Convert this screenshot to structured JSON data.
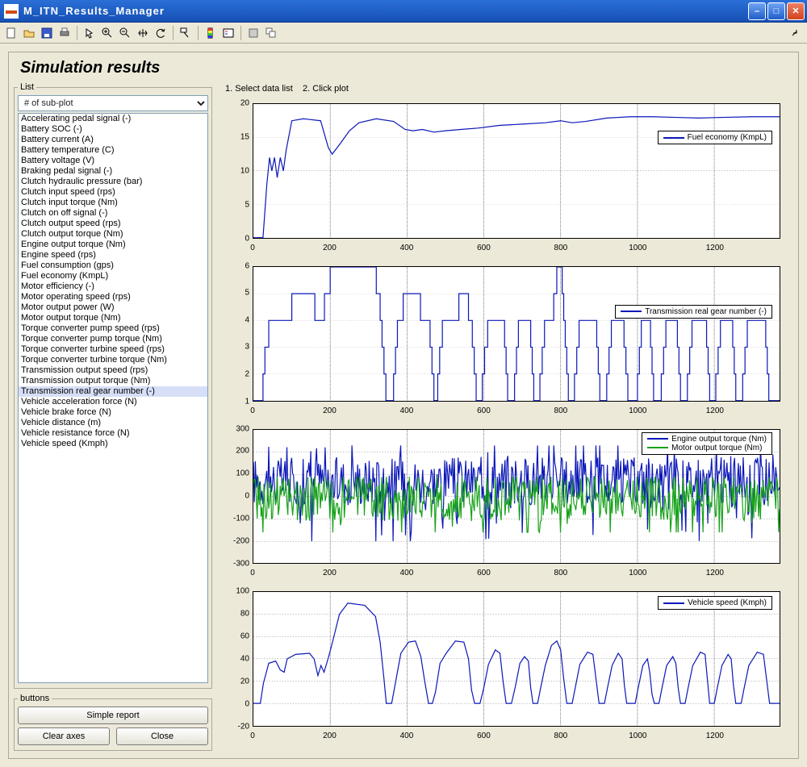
{
  "window": {
    "title": "M_ITN_Results_Manager"
  },
  "toolbar_tips": [
    "New",
    "Open",
    "Save",
    "Print",
    "Pointer",
    "Zoom In",
    "Zoom Out",
    "Pan",
    "Rotate",
    "Data Cursor",
    "Insert Colorbar",
    "Insert Legend",
    "Hide Plot",
    "Show Plot"
  ],
  "panel": {
    "title": "Simulation results"
  },
  "guide": {
    "step1": "1. Select data list",
    "step2": "2. Click plot"
  },
  "sidebar": {
    "legend_list": "List",
    "subplot_label": "# of sub-plot",
    "selected_index": 26,
    "items": [
      "Accelerating pedal signal (-)",
      "Battery SOC (-)",
      "Battery current (A)",
      "Battery temperature (C)",
      "Battery voltage (V)",
      "Braking pedal signal (-)",
      "Clutch hydraulic pressure (bar)",
      "Clutch input speed (rps)",
      "Clutch input torque (Nm)",
      "Clutch on off signal (-)",
      "Clutch output speed (rps)",
      "Clutch output torque (Nm)",
      "Engine output torque (Nm)",
      "Engine speed (rps)",
      "Fuel consumption (gps)",
      "Fuel economy (KmpL)",
      "Motor efficiency (-)",
      "Motor operating speed (rps)",
      "Motor output power (W)",
      "Motor output torque (Nm)",
      "Torque converter pump speed (rps)",
      "Torque converter pump torque (Nm)",
      "Torque converter turbine speed (rps)",
      "Torque converter turbine torque (Nm)",
      "Transmission output speed (rps)",
      "Transmission output torque (Nm)",
      "Transmission real gear number (-)",
      "Vehicle acceleration force (N)",
      "Vehicle brake force (N)",
      "Vehicle distance (m)",
      "Vehicle resistance force (N)",
      "Vehicle speed (Kmph)"
    ]
  },
  "buttons": {
    "legend": "buttons",
    "simple_report": "Simple report",
    "clear_axes": "Clear axes",
    "close": "Close"
  },
  "chart_data": [
    {
      "type": "line",
      "legend": [
        "Fuel economy (KmpL)"
      ],
      "colors": [
        "#0b17b8"
      ],
      "xlim": [
        0,
        1370
      ],
      "ylim": [
        0,
        20
      ],
      "xticks": [
        0,
        200,
        400,
        600,
        800,
        1000,
        1200
      ],
      "yticks": [
        0,
        5,
        10,
        15,
        20
      ],
      "series": [
        [
          [
            0,
            0
          ],
          [
            25,
            0
          ],
          [
            35,
            8
          ],
          [
            42,
            12
          ],
          [
            48,
            10
          ],
          [
            55,
            12
          ],
          [
            62,
            9
          ],
          [
            70,
            12
          ],
          [
            78,
            10
          ],
          [
            85,
            13
          ],
          [
            100,
            17.5
          ],
          [
            130,
            17.8
          ],
          [
            175,
            17.5
          ],
          [
            195,
            13.5
          ],
          [
            205,
            12.5
          ],
          [
            225,
            14
          ],
          [
            250,
            16
          ],
          [
            275,
            17.2
          ],
          [
            320,
            17.8
          ],
          [
            365,
            17.4
          ],
          [
            395,
            16.2
          ],
          [
            415,
            16
          ],
          [
            440,
            16.2
          ],
          [
            470,
            15.8
          ],
          [
            500,
            16
          ],
          [
            540,
            16.2
          ],
          [
            585,
            16.4
          ],
          [
            640,
            16.8
          ],
          [
            700,
            17
          ],
          [
            760,
            17.2
          ],
          [
            800,
            17.5
          ],
          [
            830,
            17.2
          ],
          [
            865,
            17.4
          ],
          [
            920,
            17.9
          ],
          [
            980,
            18.1
          ],
          [
            1040,
            18.1
          ],
          [
            1100,
            18.0
          ],
          [
            1160,
            17.9
          ],
          [
            1220,
            18.0
          ],
          [
            1300,
            18.1
          ],
          [
            1370,
            18.1
          ]
        ]
      ]
    },
    {
      "type": "step",
      "legend": [
        "Transmission real gear number (-)"
      ],
      "colors": [
        "#0b17b8"
      ],
      "xlim": [
        0,
        1370
      ],
      "ylim": [
        1,
        6
      ],
      "xticks": [
        0,
        200,
        400,
        600,
        800,
        1000,
        1200
      ],
      "yticks": [
        1,
        2,
        3,
        4,
        5,
        6
      ],
      "series": [
        [
          [
            0,
            1
          ],
          [
            20,
            1
          ],
          [
            25,
            2
          ],
          [
            30,
            3
          ],
          [
            40,
            4
          ],
          [
            95,
            4
          ],
          [
            100,
            5
          ],
          [
            155,
            5
          ],
          [
            160,
            4
          ],
          [
            180,
            4
          ],
          [
            185,
            5
          ],
          [
            195,
            5
          ],
          [
            200,
            6
          ],
          [
            315,
            6
          ],
          [
            320,
            5
          ],
          [
            330,
            4
          ],
          [
            335,
            3
          ],
          [
            340,
            2
          ],
          [
            345,
            1
          ],
          [
            360,
            1
          ],
          [
            365,
            2
          ],
          [
            370,
            3
          ],
          [
            375,
            4
          ],
          [
            385,
            4
          ],
          [
            390,
            5
          ],
          [
            430,
            5
          ],
          [
            435,
            4
          ],
          [
            455,
            4
          ],
          [
            460,
            3
          ],
          [
            465,
            2
          ],
          [
            470,
            1
          ],
          [
            476,
            1
          ],
          [
            480,
            2
          ],
          [
            485,
            3
          ],
          [
            492,
            4
          ],
          [
            530,
            4
          ],
          [
            535,
            5
          ],
          [
            555,
            5
          ],
          [
            560,
            4
          ],
          [
            570,
            3
          ],
          [
            575,
            2
          ],
          [
            580,
            1
          ],
          [
            592,
            1
          ],
          [
            596,
            2
          ],
          [
            602,
            3
          ],
          [
            610,
            4
          ],
          [
            650,
            4
          ],
          [
            654,
            3
          ],
          [
            658,
            2
          ],
          [
            662,
            1
          ],
          [
            676,
            1
          ],
          [
            680,
            2
          ],
          [
            685,
            3
          ],
          [
            690,
            4
          ],
          [
            718,
            4
          ],
          [
            722,
            3
          ],
          [
            726,
            2
          ],
          [
            730,
            1
          ],
          [
            742,
            1
          ],
          [
            746,
            2
          ],
          [
            752,
            3
          ],
          [
            758,
            4
          ],
          [
            778,
            4
          ],
          [
            782,
            5
          ],
          [
            790,
            6
          ],
          [
            800,
            6
          ],
          [
            804,
            5
          ],
          [
            808,
            4
          ],
          [
            812,
            3
          ],
          [
            816,
            2
          ],
          [
            820,
            1
          ],
          [
            832,
            1
          ],
          [
            836,
            2
          ],
          [
            842,
            3
          ],
          [
            848,
            4
          ],
          [
            890,
            4
          ],
          [
            894,
            3
          ],
          [
            898,
            2
          ],
          [
            902,
            1
          ],
          [
            916,
            1
          ],
          [
            920,
            2
          ],
          [
            926,
            3
          ],
          [
            932,
            4
          ],
          [
            960,
            4
          ],
          [
            965,
            3
          ],
          [
            970,
            2
          ],
          [
            975,
            1
          ],
          [
            996,
            1
          ],
          [
            1000,
            2
          ],
          [
            1005,
            3
          ],
          [
            1010,
            4
          ],
          [
            1030,
            4
          ],
          [
            1034,
            3
          ],
          [
            1038,
            2
          ],
          [
            1042,
            1
          ],
          [
            1058,
            1
          ],
          [
            1062,
            2
          ],
          [
            1068,
            3
          ],
          [
            1074,
            4
          ],
          [
            1100,
            4
          ],
          [
            1104,
            3
          ],
          [
            1108,
            2
          ],
          [
            1112,
            1
          ],
          [
            1126,
            1
          ],
          [
            1130,
            2
          ],
          [
            1136,
            3
          ],
          [
            1142,
            4
          ],
          [
            1176,
            4
          ],
          [
            1180,
            3
          ],
          [
            1184,
            2
          ],
          [
            1188,
            1
          ],
          [
            1200,
            1
          ],
          [
            1204,
            2
          ],
          [
            1210,
            3
          ],
          [
            1216,
            4
          ],
          [
            1244,
            4
          ],
          [
            1248,
            3
          ],
          [
            1252,
            2
          ],
          [
            1256,
            1
          ],
          [
            1270,
            1
          ],
          [
            1274,
            2
          ],
          [
            1280,
            3
          ],
          [
            1286,
            4
          ],
          [
            1330,
            4
          ],
          [
            1334,
            3
          ],
          [
            1338,
            2
          ],
          [
            1342,
            1
          ],
          [
            1370,
            1
          ]
        ]
      ]
    },
    {
      "type": "line",
      "legend": [
        "Engine output torque (Nm)",
        "Motor output torque (Nm)"
      ],
      "colors": [
        "#0b17b8",
        "#17a21a"
      ],
      "xlim": [
        0,
        1370
      ],
      "ylim": [
        -300,
        300
      ],
      "xticks": [
        0,
        200,
        400,
        600,
        800,
        1000,
        1200
      ],
      "yticks": [
        -300,
        -200,
        -100,
        0,
        100,
        200,
        300
      ]
    },
    {
      "type": "line",
      "legend": [
        "Vehicle speed (Kmph)"
      ],
      "colors": [
        "#0b17b8"
      ],
      "xlim": [
        0,
        1370
      ],
      "ylim": [
        -20,
        100
      ],
      "xticks": [
        0,
        200,
        400,
        600,
        800,
        1000,
        1200
      ],
      "yticks": [
        -20,
        0,
        20,
        40,
        60,
        80,
        100
      ],
      "series": [
        [
          [
            0,
            0
          ],
          [
            18,
            0
          ],
          [
            26,
            18
          ],
          [
            40,
            36
          ],
          [
            58,
            38
          ],
          [
            70,
            30
          ],
          [
            80,
            28
          ],
          [
            88,
            40
          ],
          [
            110,
            44
          ],
          [
            146,
            45
          ],
          [
            158,
            40
          ],
          [
            168,
            25
          ],
          [
            176,
            34
          ],
          [
            184,
            28
          ],
          [
            196,
            42
          ],
          [
            206,
            55
          ],
          [
            224,
            80
          ],
          [
            246,
            90
          ],
          [
            290,
            88
          ],
          [
            318,
            78
          ],
          [
            330,
            55
          ],
          [
            340,
            22
          ],
          [
            346,
            0
          ],
          [
            360,
            0
          ],
          [
            368,
            15
          ],
          [
            384,
            45
          ],
          [
            404,
            55
          ],
          [
            422,
            56
          ],
          [
            436,
            42
          ],
          [
            446,
            20
          ],
          [
            456,
            0
          ],
          [
            466,
            0
          ],
          [
            474,
            10
          ],
          [
            486,
            36
          ],
          [
            502,
            45
          ],
          [
            526,
            56
          ],
          [
            548,
            55
          ],
          [
            560,
            40
          ],
          [
            568,
            12
          ],
          [
            576,
            0
          ],
          [
            590,
            0
          ],
          [
            600,
            14
          ],
          [
            612,
            35
          ],
          [
            630,
            48
          ],
          [
            642,
            45
          ],
          [
            650,
            20
          ],
          [
            658,
            0
          ],
          [
            672,
            0
          ],
          [
            682,
            15
          ],
          [
            694,
            36
          ],
          [
            706,
            42
          ],
          [
            716,
            38
          ],
          [
            722,
            14
          ],
          [
            728,
            0
          ],
          [
            740,
            0
          ],
          [
            748,
            14
          ],
          [
            760,
            34
          ],
          [
            776,
            52
          ],
          [
            790,
            56
          ],
          [
            800,
            48
          ],
          [
            808,
            22
          ],
          [
            816,
            0
          ],
          [
            830,
            0
          ],
          [
            838,
            14
          ],
          [
            850,
            35
          ],
          [
            870,
            46
          ],
          [
            884,
            44
          ],
          [
            892,
            22
          ],
          [
            900,
            0
          ],
          [
            914,
            0
          ],
          [
            922,
            14
          ],
          [
            934,
            34
          ],
          [
            950,
            45
          ],
          [
            960,
            40
          ],
          [
            966,
            16
          ],
          [
            972,
            0
          ],
          [
            994,
            0
          ],
          [
            1002,
            14
          ],
          [
            1014,
            34
          ],
          [
            1026,
            40
          ],
          [
            1032,
            28
          ],
          [
            1038,
            8
          ],
          [
            1044,
            0
          ],
          [
            1056,
            0
          ],
          [
            1064,
            14
          ],
          [
            1076,
            34
          ],
          [
            1092,
            42
          ],
          [
            1100,
            36
          ],
          [
            1106,
            14
          ],
          [
            1112,
            0
          ],
          [
            1124,
            0
          ],
          [
            1132,
            14
          ],
          [
            1144,
            34
          ],
          [
            1164,
            46
          ],
          [
            1176,
            44
          ],
          [
            1182,
            22
          ],
          [
            1188,
            0
          ],
          [
            1200,
            0
          ],
          [
            1208,
            14
          ],
          [
            1220,
            34
          ],
          [
            1236,
            44
          ],
          [
            1244,
            40
          ],
          [
            1250,
            16
          ],
          [
            1256,
            0
          ],
          [
            1270,
            0
          ],
          [
            1278,
            14
          ],
          [
            1290,
            34
          ],
          [
            1312,
            46
          ],
          [
            1328,
            44
          ],
          [
            1336,
            22
          ],
          [
            1344,
            0
          ],
          [
            1370,
            0
          ]
        ]
      ]
    }
  ]
}
